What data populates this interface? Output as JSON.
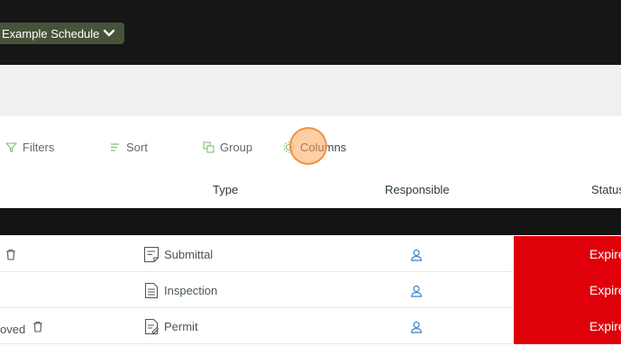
{
  "header": {
    "schedule_label": "Example Schedule"
  },
  "toolbar": {
    "filters_label": "Filters",
    "sort_label": "Sort",
    "group_label": "Group",
    "columns_label": "Columns"
  },
  "table": {
    "columns": [
      "Type",
      "Responsible",
      "Status"
    ],
    "rows": [
      {
        "left_text": "",
        "type": "Submittal",
        "status": "Expired"
      },
      {
        "left_text": "",
        "type": "Inspection",
        "status": "Expired"
      },
      {
        "left_text": "oved",
        "type": "Permit",
        "status": "Expired"
      }
    ]
  },
  "icons": {
    "schedule_dropdown": "chevron-down-icon",
    "filters": "filter-icon",
    "sort": "sort-icon",
    "group": "group-icon",
    "columns": "columns-icon",
    "submittal": "submittal-document-icon",
    "inspection": "inspection-document-icon",
    "permit": "permit-document-icon",
    "responsible": "person-icon",
    "delete": "trash-icon"
  },
  "colors": {
    "topbar": "#161616",
    "schedule_button": "#46533a",
    "subbar": "#eef0f1",
    "status_expired": "#e0000a",
    "responsible_icon": "#3b82c4",
    "tool_icon": "#7cc06e"
  }
}
